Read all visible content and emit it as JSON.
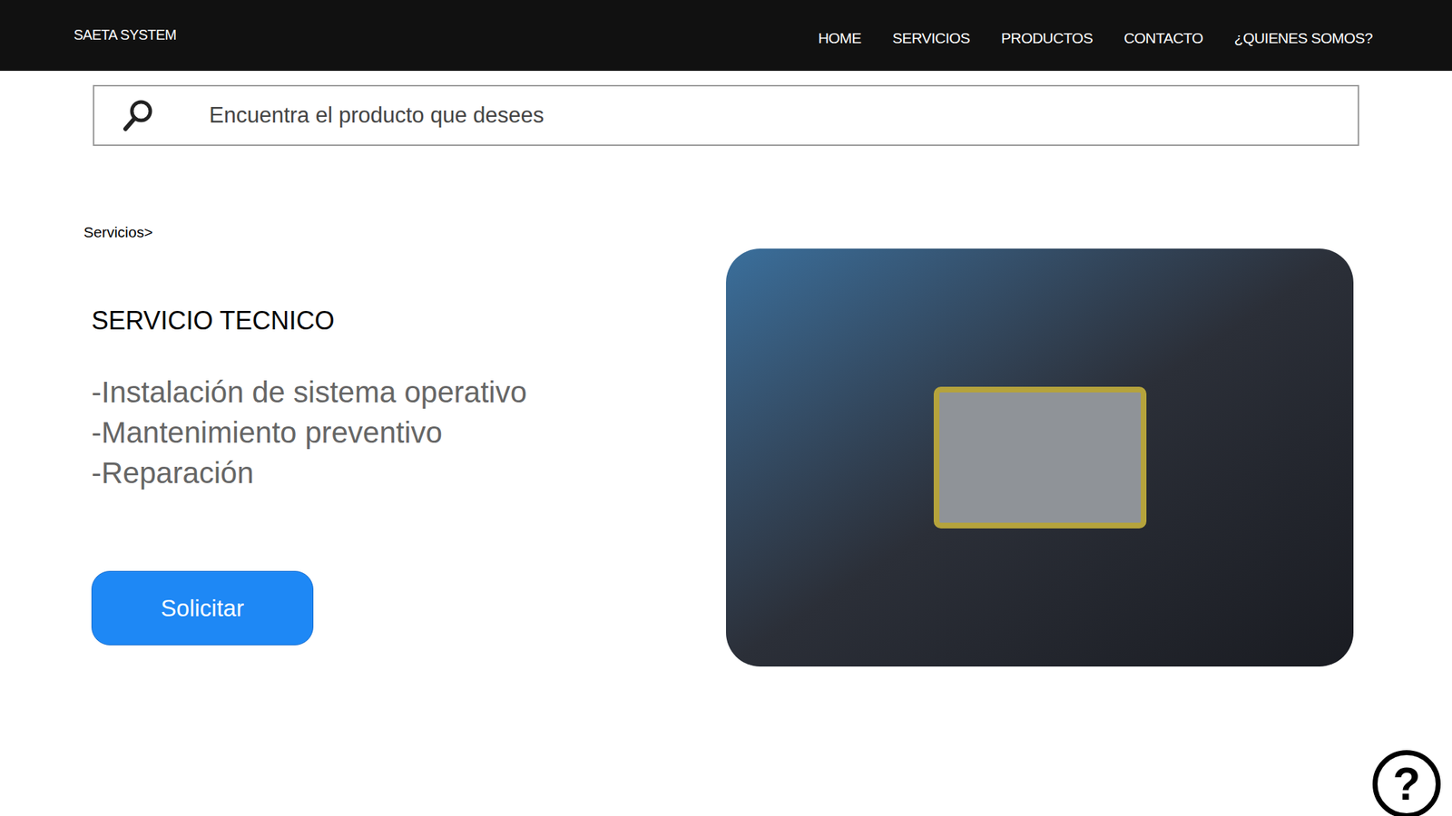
{
  "header": {
    "logo": "SAETA SYSTEM",
    "nav": [
      "HOME",
      "SERVICIOS",
      "PRODUCTOS",
      "CONTACTO",
      "¿QUIENES SOMOS?"
    ]
  },
  "search": {
    "placeholder": "Encuentra el producto que desees"
  },
  "breadcrumb": "Servicios>",
  "service": {
    "title": "SERVICIO TECNICO",
    "items": [
      "-Instalación de sistema operativo",
      "-Mantenimiento preventivo",
      "-Reparación"
    ],
    "button": "Solicitar"
  },
  "help": {
    "glyph": "?"
  }
}
